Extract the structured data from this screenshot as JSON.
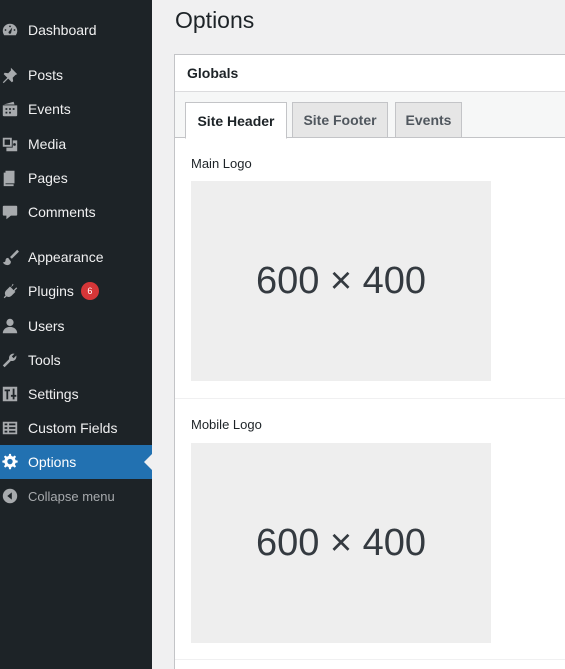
{
  "sidebar": {
    "items": [
      {
        "label": "Dashboard",
        "icon": "dashboard-icon"
      },
      {
        "label": "Posts",
        "icon": "pushpin-icon"
      },
      {
        "label": "Events",
        "icon": "events-icon"
      },
      {
        "label": "Media",
        "icon": "media-icon"
      },
      {
        "label": "Pages",
        "icon": "pages-icon"
      },
      {
        "label": "Comments",
        "icon": "comment-icon"
      },
      {
        "label": "Appearance",
        "icon": "paintbrush-icon"
      },
      {
        "label": "Plugins",
        "icon": "plugin-icon",
        "badge": "6"
      },
      {
        "label": "Users",
        "icon": "user-icon"
      },
      {
        "label": "Tools",
        "icon": "wrench-icon"
      },
      {
        "label": "Settings",
        "icon": "settings-sliders-icon"
      },
      {
        "label": "Custom Fields",
        "icon": "custom-fields-icon"
      },
      {
        "label": "Options",
        "icon": "gear-icon",
        "active": true
      },
      {
        "label": "Collapse menu",
        "icon": "collapse-arrow-icon"
      }
    ]
  },
  "main": {
    "page_title": "Options",
    "panel_title": "Globals",
    "tabs": [
      {
        "label": "Site Header",
        "active": true
      },
      {
        "label": "Site Footer"
      },
      {
        "label": "Events"
      }
    ],
    "fields": [
      {
        "label": "Main Logo",
        "image_text": "600 × 400"
      },
      {
        "label": "Mobile Logo",
        "image_text": "600 × 400"
      }
    ]
  },
  "colors": {
    "sidebar_bg": "#1d2327",
    "active_bg": "#2271b1",
    "badge_bg": "#d63638"
  }
}
